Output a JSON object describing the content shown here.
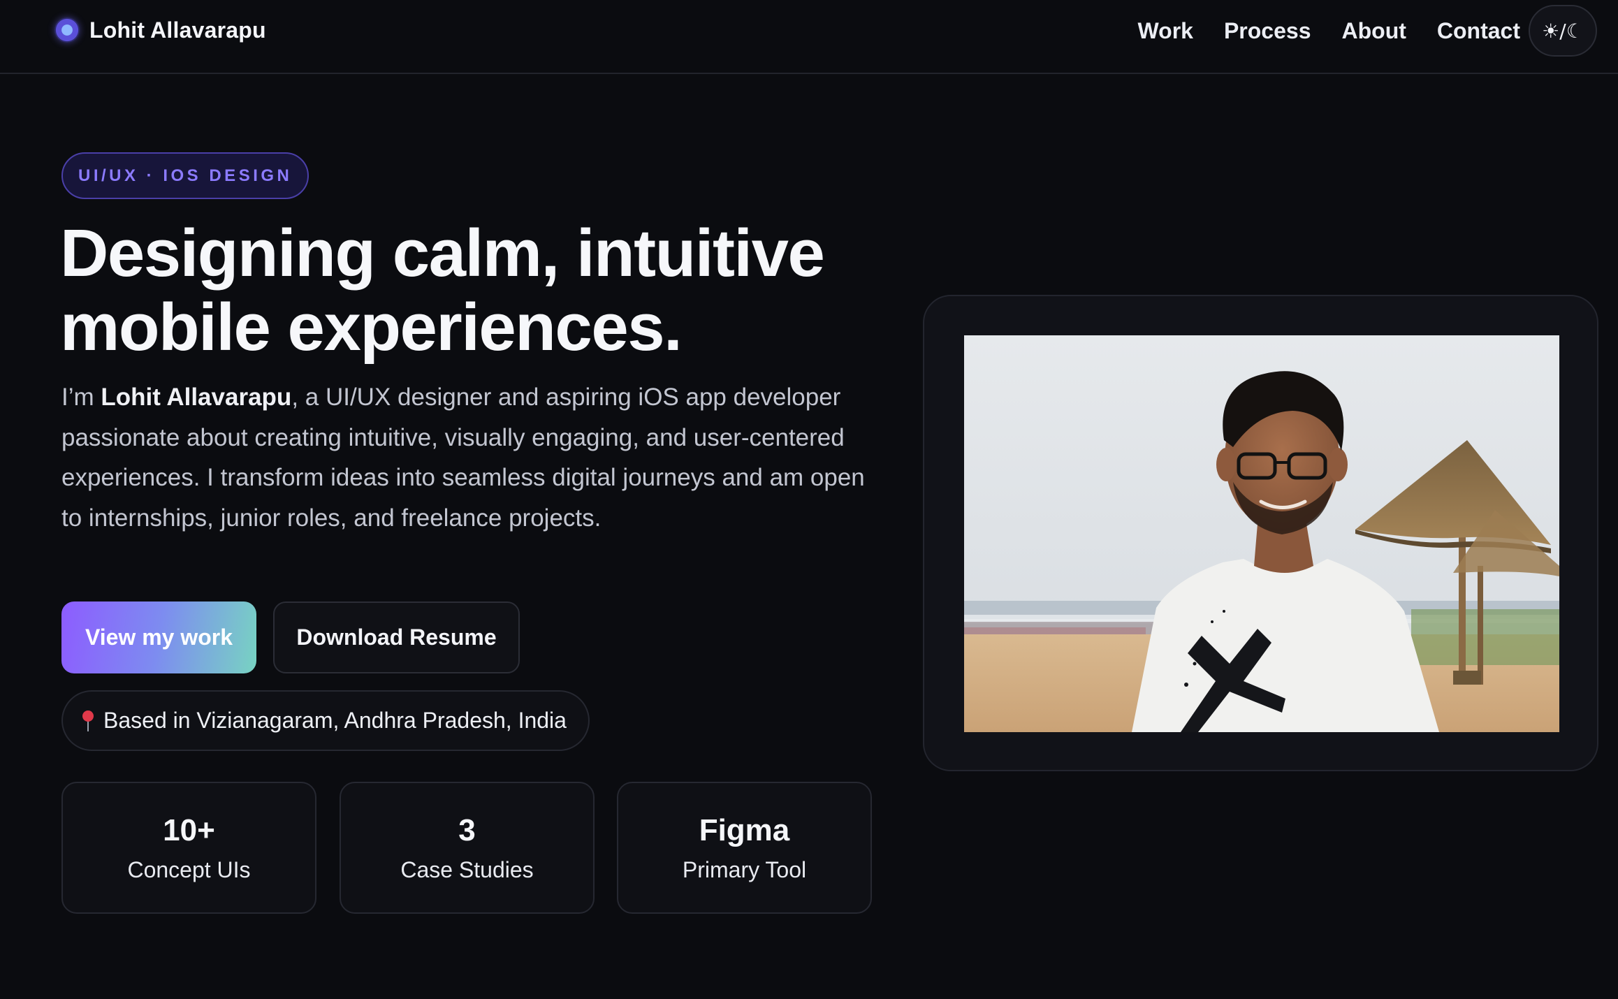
{
  "header": {
    "brand_name": "Lohit Allavarapu",
    "nav": {
      "work": "Work",
      "process": "Process",
      "about": "About",
      "contact": "Contact"
    },
    "theme_toggle_label": "☀/☾"
  },
  "hero": {
    "badge": "UI/UX · IOS DESIGN",
    "headline_line1": "Designing calm, intuitive",
    "headline_line2": "mobile experiences.",
    "intro_prefix": "I’m ",
    "intro_name": "Lohit Allavarapu",
    "intro_rest": ", a UI/UX designer and aspiring iOS app developer passionate about creating intuitive, visually engaging, and user-centered experiences. I transform ideas into seamless digital journeys and am open to internships, junior roles, and freelance projects.",
    "primary_button": "View my work",
    "secondary_button": "Download Resume",
    "location": "Based in Vizianagaram, Andhra Pradesh, India",
    "stats": [
      {
        "value": "10+",
        "label": "Concept UIs"
      },
      {
        "value": "3",
        "label": "Case Studies"
      },
      {
        "value": "Figma",
        "label": "Primary Tool"
      }
    ]
  },
  "icons": {
    "brand": "brand-logo-icon",
    "location": "map-pin-icon"
  },
  "colors": {
    "background": "#0b0c10",
    "accent": "#8c7bff",
    "button_gradient_start": "#8d5cff",
    "button_gradient_end": "#78d3c2"
  }
}
